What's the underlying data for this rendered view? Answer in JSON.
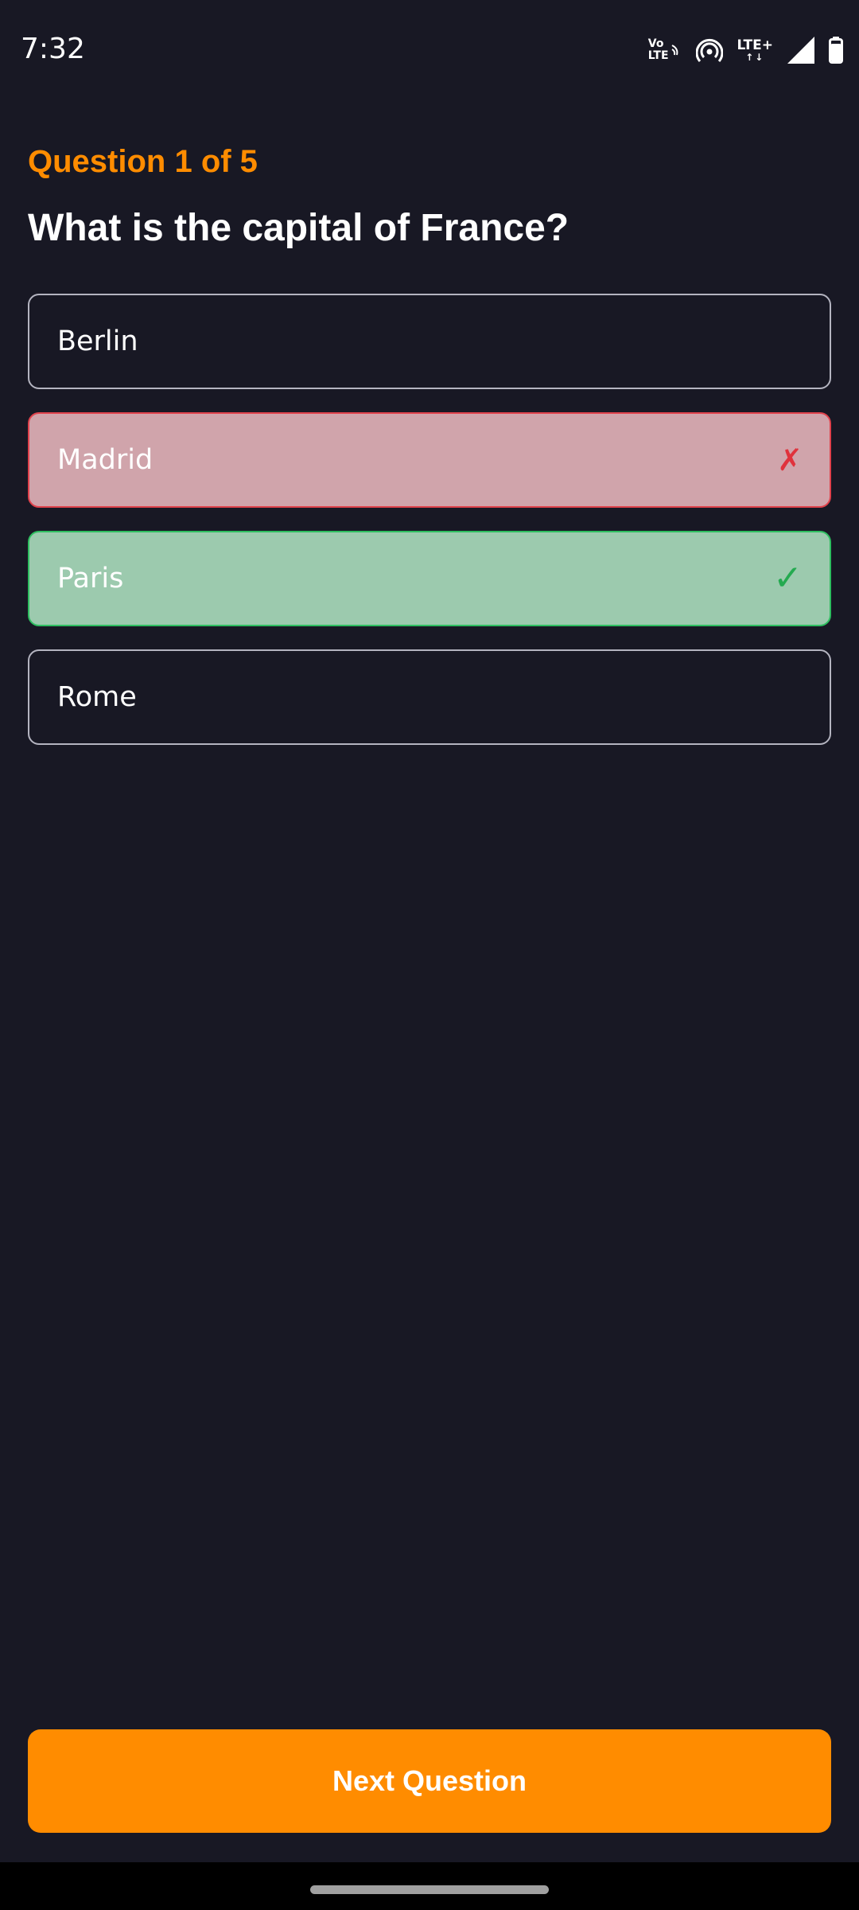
{
  "status_bar": {
    "time": "7:32",
    "volte_label_top": "Vo",
    "volte_label_bottom": "LTE",
    "network_label": "LTE+",
    "network_arrows": "↑↓",
    "icons": [
      "volte-icon",
      "hotspot-icon",
      "lte-plus-icon",
      "signal-icon",
      "battery-icon"
    ]
  },
  "quiz": {
    "counter": "Question 1 of 5",
    "question": "What is the capital of France?",
    "options": [
      {
        "label": "Berlin",
        "state": "neutral",
        "mark": ""
      },
      {
        "label": "Madrid",
        "state": "wrong",
        "mark": "✗"
      },
      {
        "label": "Paris",
        "state": "correct",
        "mark": "✓"
      },
      {
        "label": "Rome",
        "state": "neutral",
        "mark": ""
      }
    ],
    "next_button_label": "Next Question"
  },
  "colors": {
    "background": "#181824",
    "accent": "#ff8c00",
    "wrong_fill": "#d0a4ab",
    "wrong_border": "#e0424c",
    "correct_fill": "#9ccaae",
    "correct_border": "#2ebe60"
  }
}
